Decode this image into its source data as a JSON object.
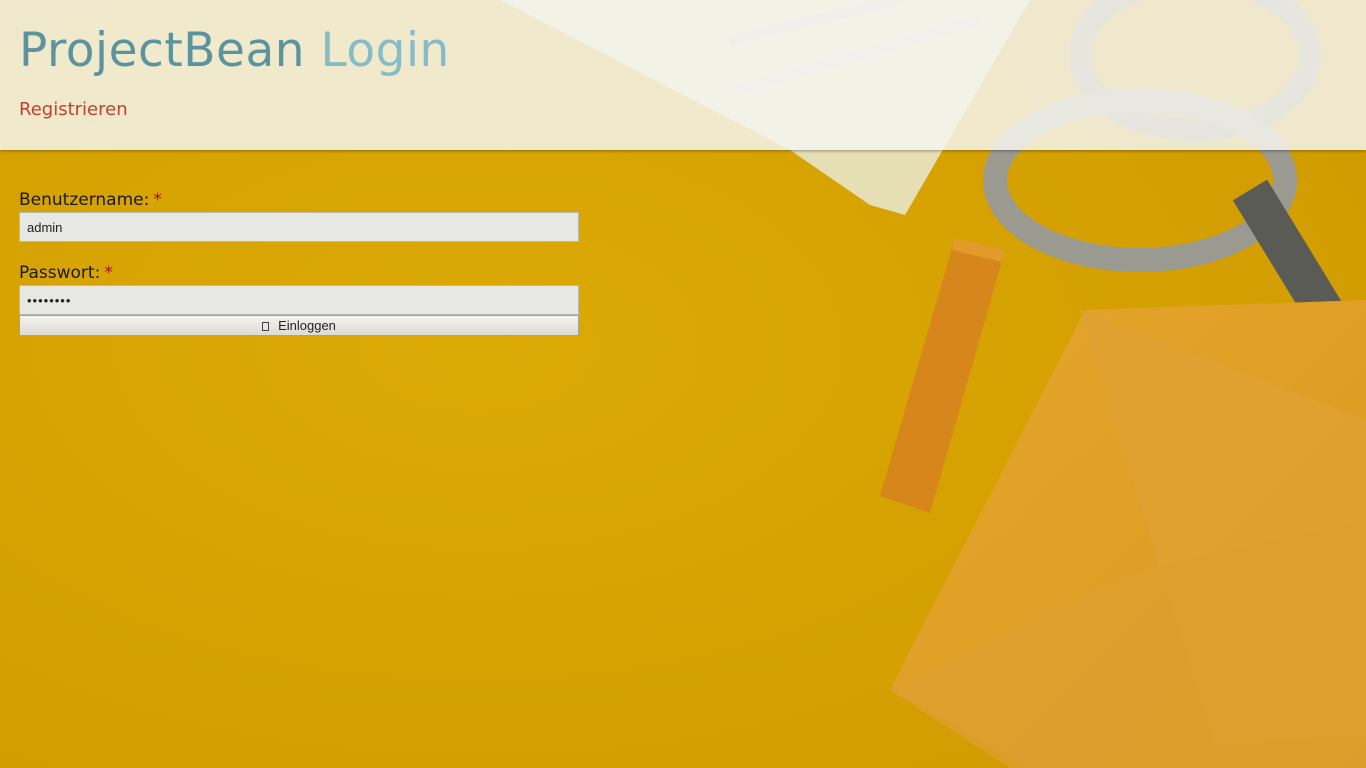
{
  "header": {
    "title_part1": "ProjectBean",
    "title_part2": "Login",
    "register_link": "Registrieren"
  },
  "form": {
    "username": {
      "label": "Benutzername:",
      "required_marker": "*",
      "value": "admin"
    },
    "password": {
      "label": "Passwort:",
      "required_marker": "*",
      "value": "adminadm"
    },
    "submit": {
      "icon": "login-icon",
      "label": "Einloggen"
    }
  },
  "colors": {
    "title_primary": "#5b949f",
    "title_secondary": "#86bcc8",
    "link": "#c0412f",
    "required": "#9e1111",
    "background": "#d8a300"
  }
}
